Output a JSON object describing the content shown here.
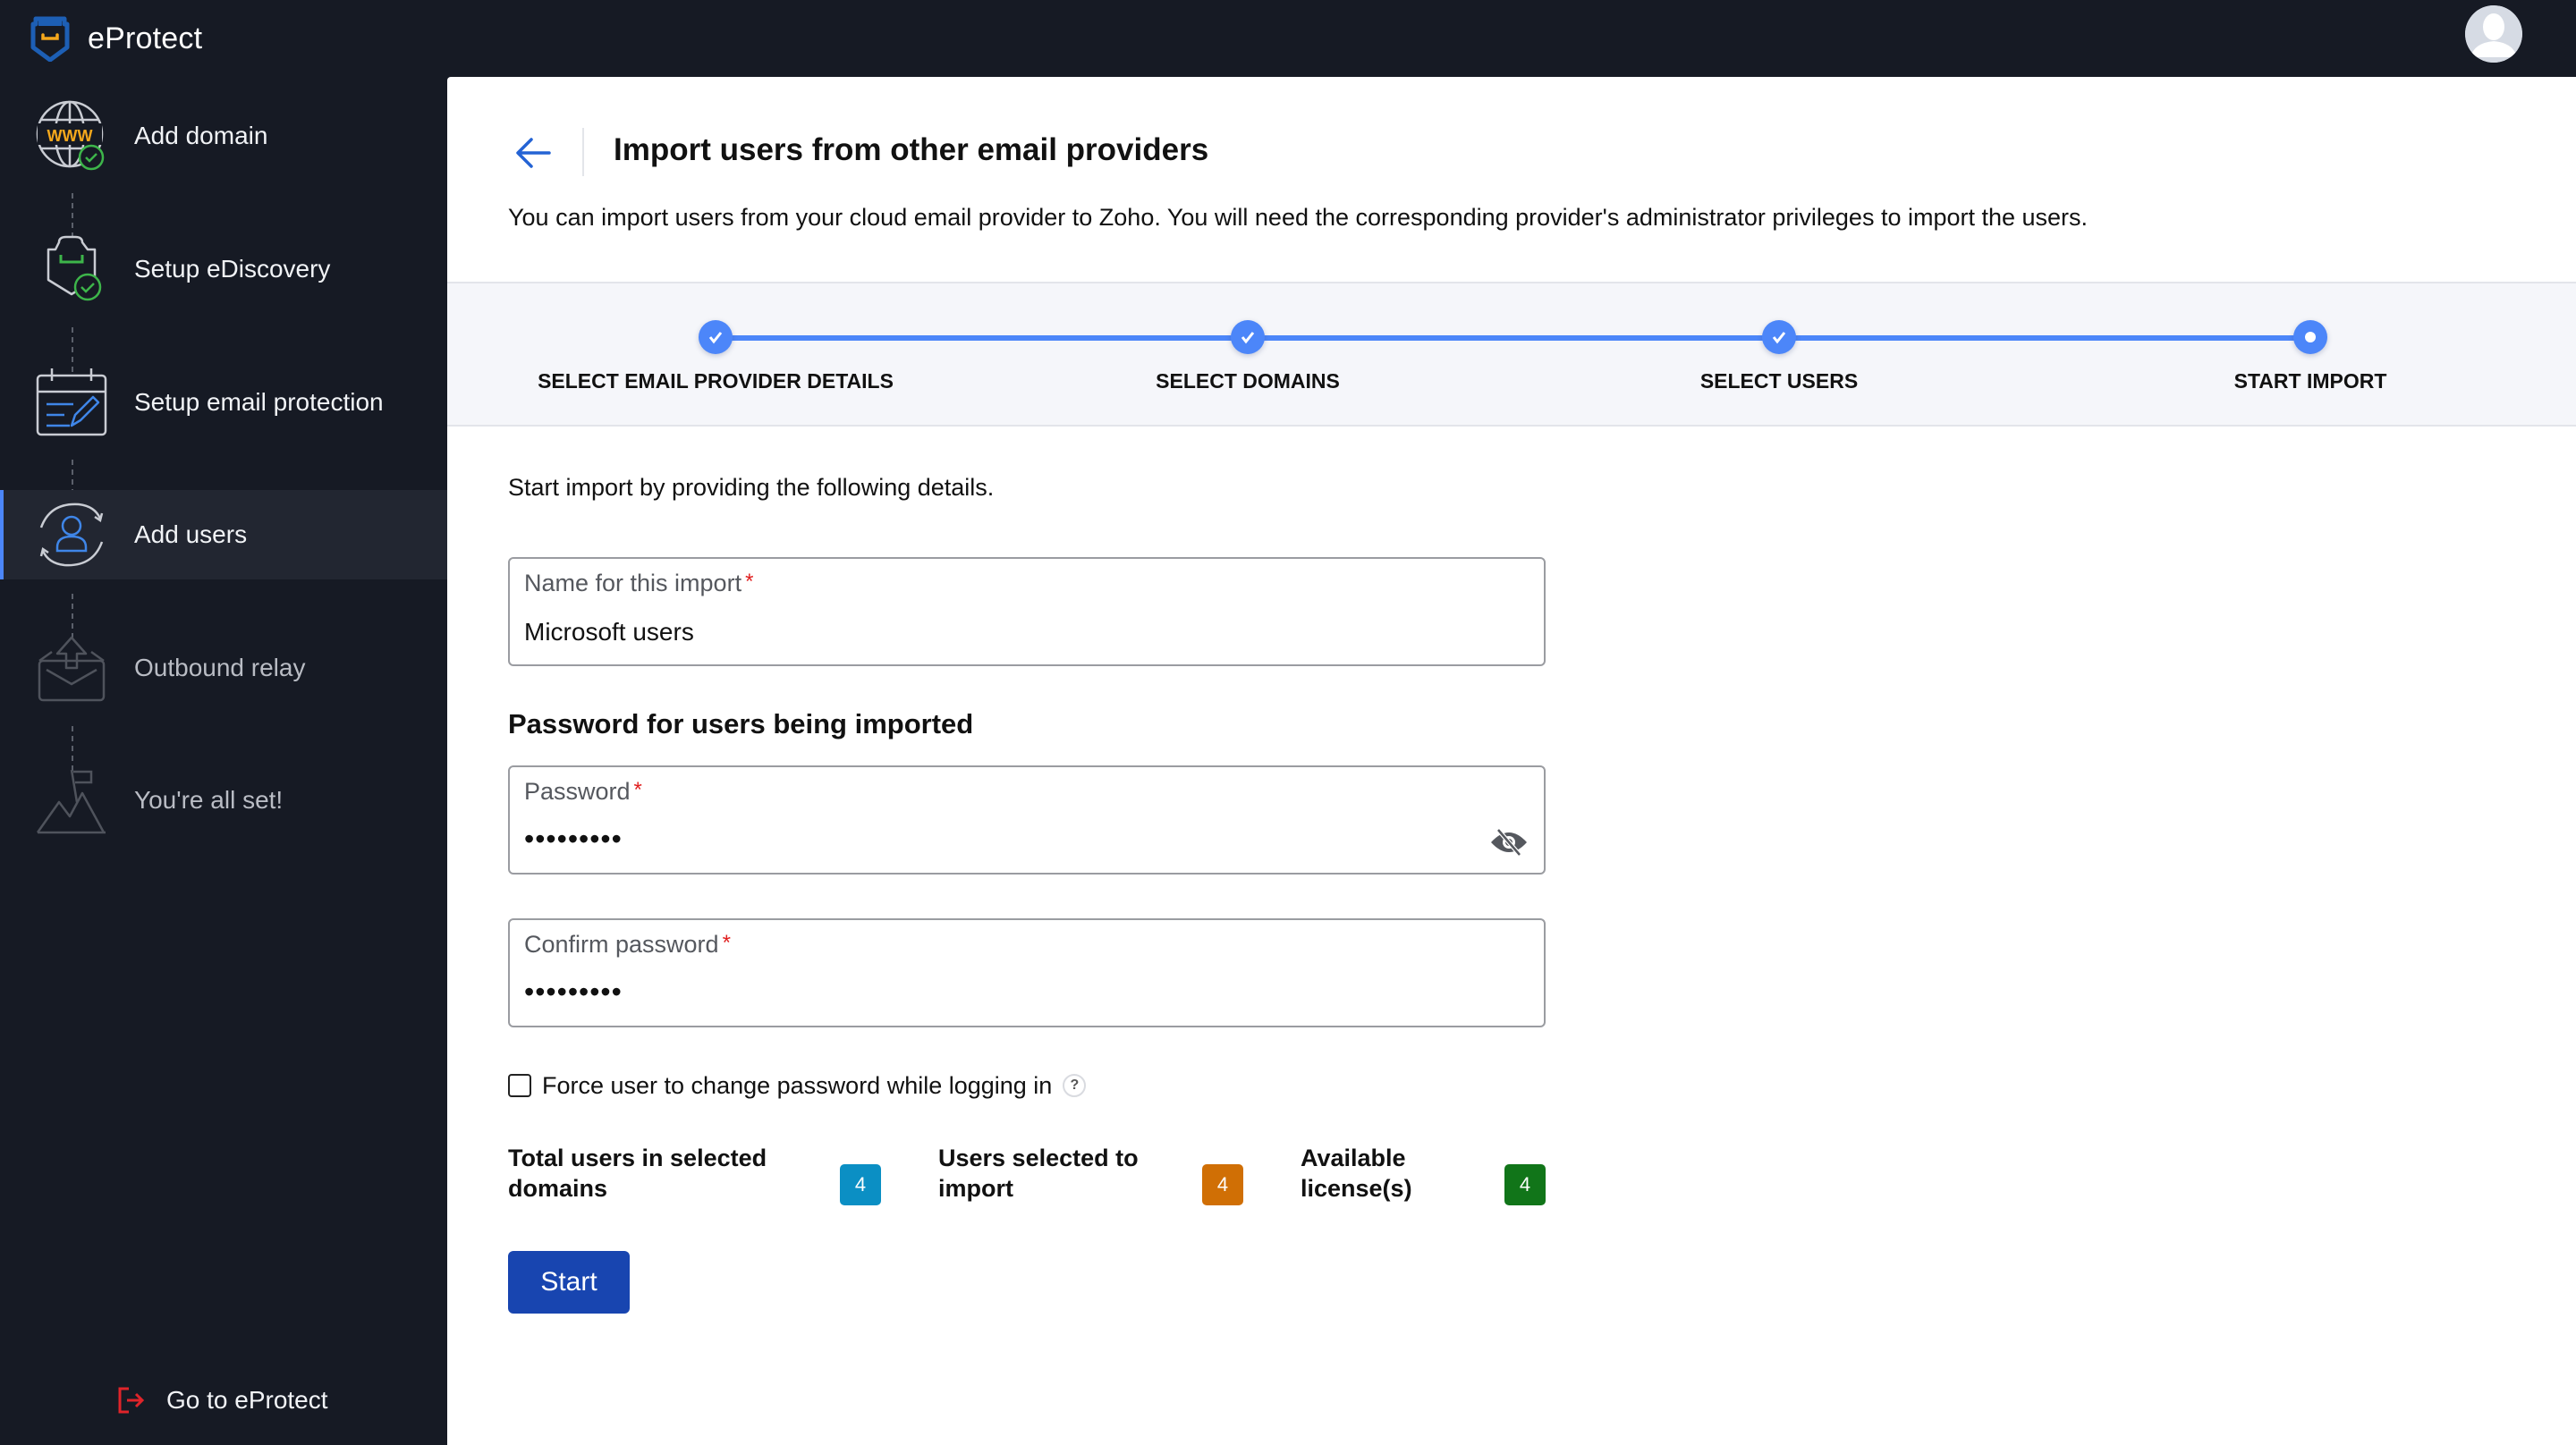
{
  "app": {
    "name": "eProtect",
    "brand_color": "#1d5fb5",
    "accent_color": "#4c86f9"
  },
  "sidebar": {
    "items": [
      {
        "label": "Add domain",
        "icon": "globe-www-check-icon",
        "state": "completed"
      },
      {
        "label": "Setup eDiscovery",
        "icon": "archive-shield-check-icon",
        "state": "completed"
      },
      {
        "label": "Setup email protection",
        "icon": "calendar-edit-icon",
        "state": "completed"
      },
      {
        "label": "Add users",
        "icon": "user-sync-icon",
        "state": "active"
      },
      {
        "label": "Outbound relay",
        "icon": "outbox-envelope-icon",
        "state": "disabled"
      },
      {
        "label": "You're all set!",
        "icon": "mountain-flag-icon",
        "state": "disabled"
      }
    ],
    "footer_link": {
      "label": "Go to eProtect",
      "icon": "exit-arrow-icon"
    }
  },
  "header": {
    "avatar": "user-avatar-icon"
  },
  "main": {
    "back_icon": "arrow-left-icon",
    "title": "Import users from other email providers",
    "description": "You can import users from your cloud email provider to Zoho. You will need the corresponding provider's administrator privileges to import the users.",
    "steps": [
      {
        "label": "SELECT EMAIL PROVIDER DETAILS",
        "status": "done"
      },
      {
        "label": "SELECT DOMAINS",
        "status": "done"
      },
      {
        "label": "SELECT USERS",
        "status": "done"
      },
      {
        "label": "START IMPORT",
        "status": "current"
      }
    ],
    "form": {
      "intro": "Start import by providing the following details.",
      "import_name": {
        "label": "Name for this import",
        "required_mark": "*",
        "value": "Microsoft users"
      },
      "password_section_title": "Password for users being imported",
      "password": {
        "label": "Password",
        "required_mark": "*",
        "value": "•••••••••",
        "toggle_icon": "eye-off-icon"
      },
      "confirm_password": {
        "label": "Confirm password",
        "required_mark": "*",
        "value": "•••••••••"
      },
      "force_change": {
        "label": "Force user to change password while logging in",
        "checked": false,
        "help": "?"
      }
    },
    "stats": [
      {
        "label_line1": "Total users in selected",
        "label_line2": "domains",
        "value": "4",
        "color": "#0b8fc4"
      },
      {
        "label_line1": "Users selected to",
        "label_line2": "import",
        "value": "4",
        "color": "#d06f05"
      },
      {
        "label_line1": "Available",
        "label_line2": "license(s)",
        "value": "4",
        "color": "#117519"
      }
    ],
    "start_button": "Start"
  }
}
